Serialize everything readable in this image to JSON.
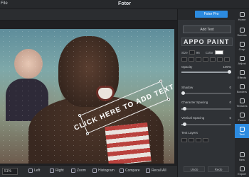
{
  "titlebar": {
    "menu_label": "File",
    "app_title": "Fotor"
  },
  "canvas": {
    "overlay_text": "CLICK HERE TO ADD TEXT"
  },
  "statusbar": {
    "zoom_value": "51%",
    "items": [
      {
        "label": "Left",
        "icon": "rotate-left-icon"
      },
      {
        "label": "Right",
        "icon": "rotate-right-icon"
      },
      {
        "label": "Zoom",
        "icon": "zoom-icon"
      },
      {
        "label": "Histogram",
        "icon": "histogram-icon"
      },
      {
        "label": "Compare",
        "icon": "compare-icon"
      },
      {
        "label": "Recall All",
        "icon": "recall-icon"
      }
    ]
  },
  "panel": {
    "fotor_pro_label": "Fotor Pro",
    "add_text_label": "Add Text",
    "font_name": "APPO PAINT",
    "size_label": "Size",
    "size_value": "96",
    "color_label": "Color",
    "opacity_label": "Opacity",
    "opacity_value": "100%",
    "opacity_level": 1.0,
    "shadow_label": "Shadow",
    "shadow_value": "0",
    "shadow_level": 0.0,
    "char_spacing_label": "Character Spacing",
    "char_spacing_value": "0",
    "char_spacing_level": 0.05,
    "vert_spacing_label": "Vertical Spacing",
    "vert_spacing_value": "0",
    "vert_spacing_level": 0.05,
    "text_layers_label": "Text Layers",
    "undo_label": "Undo",
    "redo_label": "Redo"
  },
  "sidebar": {
    "items": [
      {
        "label": "Home",
        "icon": "home-icon"
      },
      {
        "label": "Scenes",
        "icon": "scenes-icon"
      },
      {
        "label": "Crop",
        "icon": "crop-icon"
      },
      {
        "label": "Adjust",
        "icon": "adjust-icon"
      },
      {
        "label": "Effects",
        "icon": "effects-icon"
      },
      {
        "label": "Borders",
        "icon": "borders-icon"
      },
      {
        "label": "Textures",
        "icon": "textures-icon"
      },
      {
        "label": "Focus",
        "icon": "focus-icon"
      },
      {
        "label": "Text",
        "icon": "text-icon"
      },
      {
        "label": "New",
        "icon": "new-icon"
      },
      {
        "label": "Export",
        "icon": "export-icon"
      }
    ],
    "active_index": 8
  }
}
